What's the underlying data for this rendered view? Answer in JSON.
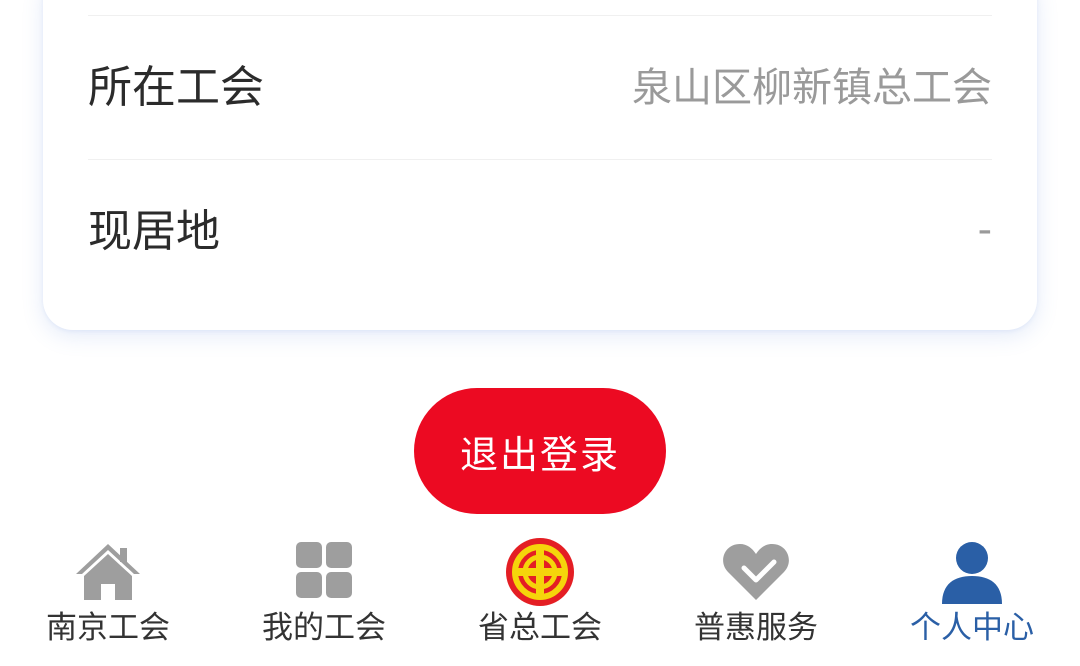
{
  "profile": {
    "rows": [
      {
        "label": "所在工会",
        "value": "泉山区柳新镇总工会"
      },
      {
        "label": "现居地",
        "value": "-"
      }
    ]
  },
  "actions": {
    "logout_label": "退出登录"
  },
  "tabbar": {
    "items": [
      {
        "label": "南京工会",
        "icon": "home-icon",
        "active": false
      },
      {
        "label": "我的工会",
        "icon": "grid-icon",
        "active": false
      },
      {
        "label": "省总工会",
        "icon": "union-emblem-icon",
        "active": false
      },
      {
        "label": "普惠服务",
        "icon": "heart-icon",
        "active": false
      },
      {
        "label": "个人中心",
        "icon": "user-icon",
        "active": true
      }
    ]
  },
  "colors": {
    "accent": "#ec0a22",
    "active_tab": "#2a5fa6",
    "inactive_icon": "#9e9e9e",
    "emblem_red": "#e41e24",
    "emblem_yellow": "#f5d50b"
  }
}
